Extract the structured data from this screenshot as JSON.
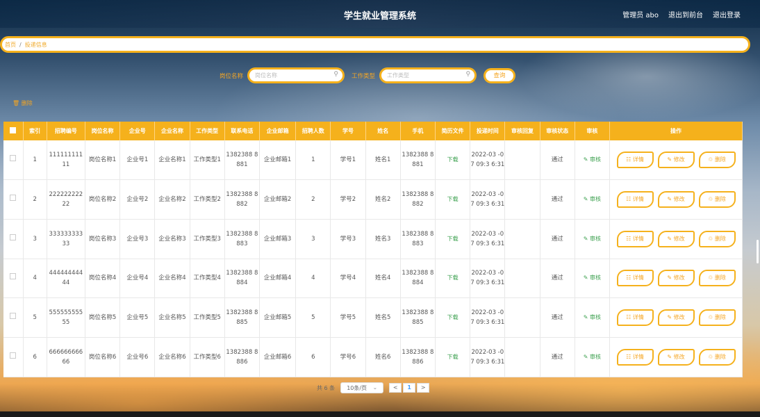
{
  "header": {
    "title": "学生就业管理系统",
    "user_label": "管理员 abo",
    "front_link": "退出到前台",
    "logout_link": "退出登录"
  },
  "breadcrumb": {
    "home": "首页",
    "separator": "/",
    "current": "投递信息"
  },
  "search": {
    "position_label": "岗位名称",
    "position_placeholder": "岗位名称",
    "type_label": "工作类型",
    "type_placeholder": "工作类型",
    "button": "查询"
  },
  "toolbar": {
    "delete_label": "删除"
  },
  "table": {
    "headers": [
      "索引",
      "招聘编号",
      "岗位名称",
      "企业号",
      "企业名称",
      "工作类型",
      "联系电话",
      "企业邮箱",
      "招聘人数",
      "学号",
      "姓名",
      "手机",
      "简历文件",
      "投递时间",
      "审核回复",
      "审核状态",
      "审核",
      "操作"
    ],
    "rows": [
      {
        "idx": "1",
        "recruit_no": "111111111 11",
        "position": "岗位名称1",
        "company_no": "企业号1",
        "company": "企业名称1",
        "job_type": "工作类型1",
        "phone": "1382388 8881",
        "email": "企业邮箱1",
        "count": "1",
        "student_no": "学号1",
        "name": "姓名1",
        "mobile": "1382388 8881",
        "resume": "下载",
        "time": "2022-03 -07 09:3 6:31",
        "reply": "",
        "status": "通过",
        "review": "审核"
      },
      {
        "idx": "2",
        "recruit_no": "222222222 22",
        "position": "岗位名称2",
        "company_no": "企业号2",
        "company": "企业名称2",
        "job_type": "工作类型2",
        "phone": "1382388 8882",
        "email": "企业邮箱2",
        "count": "2",
        "student_no": "学号2",
        "name": "姓名2",
        "mobile": "1382388 8882",
        "resume": "下载",
        "time": "2022-03 -07 09:3 6:31",
        "reply": "",
        "status": "通过",
        "review": "审核"
      },
      {
        "idx": "3",
        "recruit_no": "333333333 33",
        "position": "岗位名称3",
        "company_no": "企业号3",
        "company": "企业名称3",
        "job_type": "工作类型3",
        "phone": "1382388 8883",
        "email": "企业邮箱3",
        "count": "3",
        "student_no": "学号3",
        "name": "姓名3",
        "mobile": "1382388 8883",
        "resume": "下载",
        "time": "2022-03 -07 09:3 6:31",
        "reply": "",
        "status": "通过",
        "review": "审核"
      },
      {
        "idx": "4",
        "recruit_no": "444444444 44",
        "position": "岗位名称4",
        "company_no": "企业号4",
        "company": "企业名称4",
        "job_type": "工作类型4",
        "phone": "1382388 8884",
        "email": "企业邮箱4",
        "count": "4",
        "student_no": "学号4",
        "name": "姓名4",
        "mobile": "1382388 8884",
        "resume": "下载",
        "time": "2022-03 -07 09:3 6:31",
        "reply": "",
        "status": "通过",
        "review": "审核"
      },
      {
        "idx": "5",
        "recruit_no": "555555555 55",
        "position": "岗位名称5",
        "company_no": "企业号5",
        "company": "企业名称5",
        "job_type": "工作类型5",
        "phone": "1382388 8885",
        "email": "企业邮箱5",
        "count": "5",
        "student_no": "学号5",
        "name": "姓名5",
        "mobile": "1382388 8885",
        "resume": "下载",
        "time": "2022-03 -07 09:3 6:31",
        "reply": "",
        "status": "通过",
        "review": "审核"
      },
      {
        "idx": "6",
        "recruit_no": "666666666 66",
        "position": "岗位名称6",
        "company_no": "企业号6",
        "company": "企业名称6",
        "job_type": "工作类型6",
        "phone": "1382388 8886",
        "email": "企业邮箱6",
        "count": "6",
        "student_no": "学号6",
        "name": "姓名6",
        "mobile": "1382388 8886",
        "resume": "下载",
        "time": "2022-03 -07 09:3 6:31",
        "reply": "",
        "status": "通过",
        "review": "审核"
      }
    ],
    "actions": {
      "detail": "详情",
      "edit": "修改",
      "delete": "删除"
    }
  },
  "pagination": {
    "total": "共 6 条",
    "page_size": "10条/页",
    "prev": "<",
    "current": "1",
    "next": ">"
  },
  "colors": {
    "accent": "#f5b11c",
    "link_green": "#3a9f4d"
  }
}
